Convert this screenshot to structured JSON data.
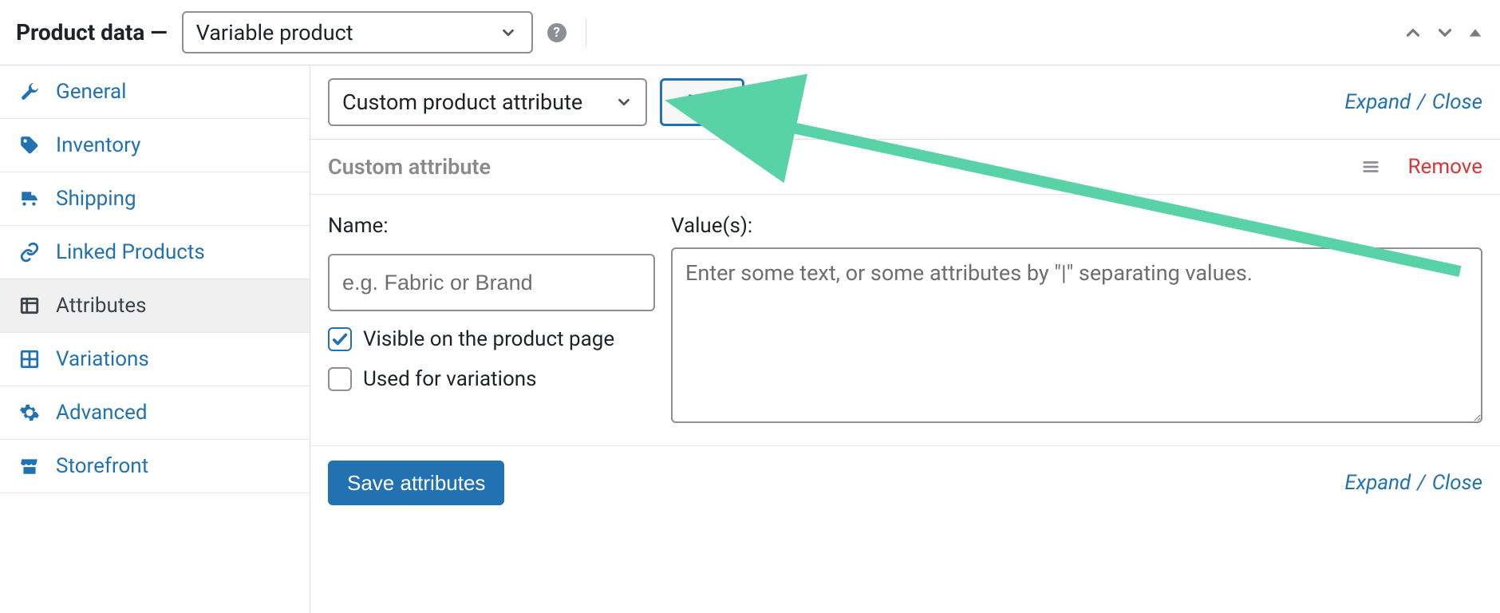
{
  "header": {
    "title": "Product data —",
    "product_type": "Variable product"
  },
  "sidebar": {
    "items": [
      {
        "label": "General",
        "icon": "wrench-icon",
        "active": false
      },
      {
        "label": "Inventory",
        "icon": "tag-icon",
        "active": false
      },
      {
        "label": "Shipping",
        "icon": "truck-icon",
        "active": false
      },
      {
        "label": "Linked Products",
        "icon": "link-icon",
        "active": false
      },
      {
        "label": "Attributes",
        "icon": "list-icon",
        "active": true
      },
      {
        "label": "Variations",
        "icon": "grid-icon",
        "active": false
      },
      {
        "label": "Advanced",
        "icon": "gear-icon",
        "active": false
      },
      {
        "label": "Storefront",
        "icon": "store-icon",
        "active": false
      }
    ]
  },
  "toolbar": {
    "attribute_select": "Custom product attribute",
    "add_label": "Add",
    "expand_label": "Expand",
    "close_label": "Close"
  },
  "attribute": {
    "title": "Custom attribute",
    "remove_label": "Remove",
    "name_label": "Name:",
    "name_placeholder": "e.g. Fabric or Brand",
    "name_value": "",
    "values_label": "Value(s):",
    "values_placeholder": "Enter some text, or some attributes by \"|\" separating values.",
    "values_value": "",
    "visible_label": "Visible on the product page",
    "visible_checked": true,
    "variations_label": "Used for variations",
    "variations_checked": false
  },
  "footer": {
    "save_label": "Save attributes",
    "expand_label": "Expand",
    "close_label": "Close"
  },
  "colors": {
    "link": "#2271b1",
    "danger": "#d63638",
    "accent_arrow": "#59d2a8"
  }
}
